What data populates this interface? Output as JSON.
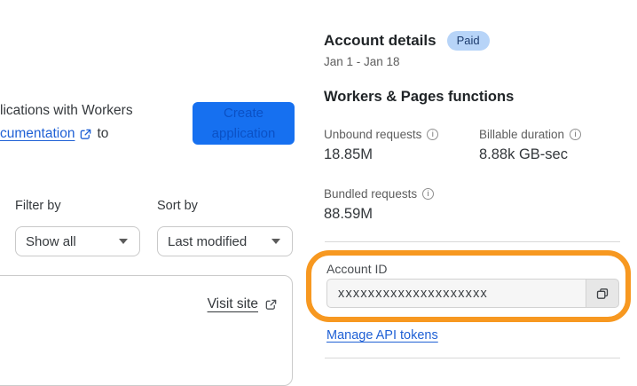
{
  "colors": {
    "accent-orange": "#f79820",
    "button-blue": "#1670f0",
    "button-text-blue": "#0b51c5",
    "link-blue": "#2061d5",
    "badge-bg": "#b7d4f8",
    "badge-text": "#1d3c6e"
  },
  "left_panel": {
    "intro": {
      "line1": "lications with Workers",
      "line2_link": "cumentation",
      "line2_after": "to"
    },
    "create_button_label": "Create application",
    "filter": {
      "label": "Filter by",
      "selected": "Show all"
    },
    "sort": {
      "label": "Sort by",
      "selected": "Last modified"
    },
    "project_card": {
      "visit_site_label": "Visit site"
    }
  },
  "account_panel": {
    "title": "Account details",
    "plan_badge": "Paid",
    "date_range": "Jan 1 - Jan 18",
    "functions_section": {
      "title": "Workers & Pages functions",
      "stats": [
        {
          "label": "Unbound requests",
          "value": "18.85M"
        },
        {
          "label": "Billable duration",
          "value": "8.88k GB-sec"
        },
        {
          "label": "Bundled requests",
          "value": "88.59M"
        }
      ]
    },
    "account_id": {
      "label": "Account ID",
      "value": "xxxxxxxxxxxxxxxxxxxx"
    },
    "manage_api_tokens_label": "Manage API tokens"
  }
}
